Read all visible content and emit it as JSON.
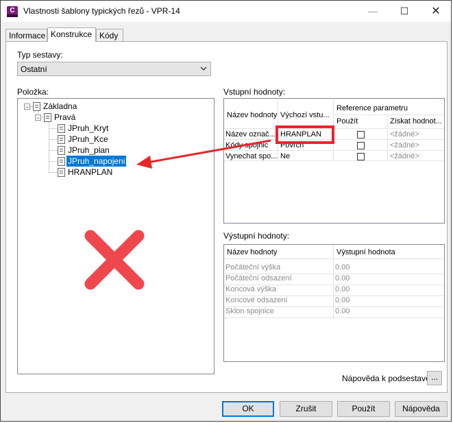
{
  "window": {
    "title": "Vlastnosti šablony typických řezů - VPR-14",
    "app_icon_letter": "C",
    "min_glyph": "—",
    "max_glyph": "☐",
    "close_glyph": "✕"
  },
  "tabs": [
    "Informace",
    "Konstrukce",
    "Kódy"
  ],
  "assembly_type": {
    "label": "Typ sestavy:",
    "value": "Ostatní"
  },
  "items": {
    "label": "Položka:",
    "tree": [
      {
        "label": "Základna"
      },
      {
        "label": "Pravá"
      },
      {
        "label": "JPruh_Kryt"
      },
      {
        "label": "JPruh_Kce"
      },
      {
        "label": "JPruh_plan"
      },
      {
        "label": "JPruh_napojeni"
      },
      {
        "label": "HRANPLAN"
      }
    ]
  },
  "inputs": {
    "label": "Vstupní hodnoty:",
    "headers": {
      "name": "Název hodnoty",
      "default": "Výchozí vstu...",
      "ref": "Reference parametru",
      "use": "Použít",
      "get": "Získat hodnot..."
    },
    "rows": [
      {
        "name": "Název označ...",
        "default": "HRANPLAN",
        "ref": "<žádné>"
      },
      {
        "name": "Kódy spojnic",
        "default": "Povrch",
        "ref": "<žádné>"
      },
      {
        "name": "Vynechat spo...",
        "default": "Ne",
        "ref": "<žádné>"
      }
    ]
  },
  "outputs": {
    "label": "Výstupní hodnoty:",
    "headers": {
      "name": "Název hodnoty",
      "value": "Výstupní hodnota"
    },
    "rows": [
      {
        "name": "Počáteční výška",
        "value": "0.00"
      },
      {
        "name": "Počáteční odsazení",
        "value": "0.00"
      },
      {
        "name": "Koncová výška",
        "value": "0.00"
      },
      {
        "name": "Koncové odsazení",
        "value": "0.00"
      },
      {
        "name": "Sklon spojnice",
        "value": "0.00"
      }
    ]
  },
  "help_subassembly": {
    "label": "Nápověda k podsestavě:",
    "button": "..."
  },
  "buttons": {
    "ok": "OK",
    "cancel": "Zrušit",
    "apply": "Použít",
    "help": "Nápověda"
  },
  "colors": {
    "annotation_red": "#e8262a",
    "cross_red": "#f0474c",
    "selection": "#0078d7"
  }
}
